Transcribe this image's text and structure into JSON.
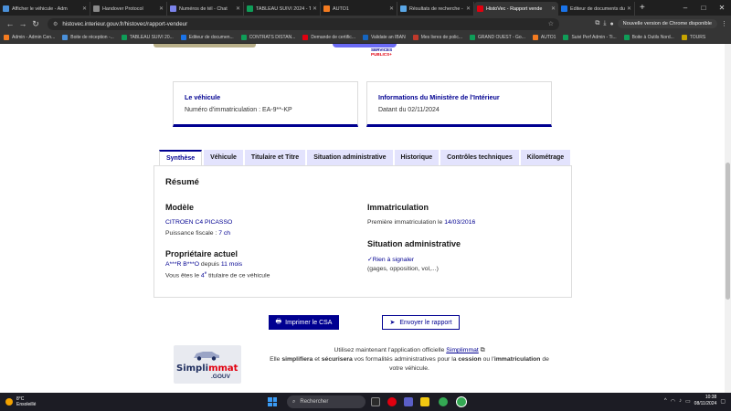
{
  "browser": {
    "tabs": [
      {
        "label": "Afficher le véhicule - Adm",
        "fav": "#4a90d9",
        "w": 99,
        "active": false
      },
      {
        "label": "Handover Protocol",
        "fav": "#8a8a8a",
        "w": 84,
        "active": false
      },
      {
        "label": "Numéros de tél - Chat",
        "fav": "#7b83eb",
        "w": 84,
        "active": false
      },
      {
        "label": "TABLEAU SUIVI 2024 - TO",
        "fav": "#0f9d58",
        "w": 84,
        "active": false
      },
      {
        "label": "AUTO1",
        "fav": "#f47b20",
        "w": 84,
        "active": false
      },
      {
        "label": "Résultats de recherche -",
        "fav": "#5aa7e6",
        "w": 84,
        "active": false
      },
      {
        "label": "HistoVec - Rapport vende",
        "fav": "#e1000f",
        "w": 92,
        "active": true
      },
      {
        "label": "Editeur de documents du",
        "fav": "#1a73e8",
        "w": 84,
        "active": false
      }
    ],
    "url": "histovec.interieur.gouv.fr/histovec/rapport-vendeur",
    "update_label": "Nouvelle version de Chrome disponible",
    "bookmarks": [
      {
        "label": "Admin - Admin Cen...",
        "fav": "#f47b20"
      },
      {
        "label": "Boite de réception -...",
        "fav": "#4a90d9"
      },
      {
        "label": "TABLEAU SUIVI 20...",
        "fav": "#0f9d58"
      },
      {
        "label": "Editeur de documen...",
        "fav": "#1a73e8"
      },
      {
        "label": "CONTRATS DISTAN...",
        "fav": "#0f9d58"
      },
      {
        "label": "Demande de certific...",
        "fav": "#e1000f"
      },
      {
        "label": "Validate an IBAN",
        "fav": "#1565c0"
      },
      {
        "label": "Mes livres de polic...",
        "fav": "#c0392b"
      },
      {
        "label": "GRAND OUEST - Go...",
        "fav": "#0f9d58"
      },
      {
        "label": "AUTO1",
        "fav": "#f47b20"
      },
      {
        "label": "Suivi Perf Admin - Ti...",
        "fav": "#0f9d58"
      },
      {
        "label": "Boite à Outils Nord...",
        "fav": "#0f9d58"
      },
      {
        "label": "TOURS",
        "fav": "#c7a400"
      }
    ]
  },
  "header": {
    "logo_top": "SERVICES",
    "logo_bottom": "PUBLICS+"
  },
  "cards": {
    "vehicle_title": "Le véhicule",
    "vehicle_text": "Numéro d'immatriculation : EA-9**-KP",
    "ministry_title": "Informations du Ministère de l'Intérieur",
    "ministry_text": "Datant du 02/11/2024"
  },
  "tabs": [
    "Synthèse",
    "Véhicule",
    "Titulaire et Titre",
    "Situation administrative",
    "Historique",
    "Contrôles techniques",
    "Kilométrage"
  ],
  "summary": {
    "title": "Résumé",
    "model_h": "Modèle",
    "model_name": "CITROEN C4 PICASSO",
    "fiscal_label": "Puissance fiscale : ",
    "fiscal_value": "7 ch",
    "owner_h": "Propriétaire actuel",
    "owner_name": "A***R B***O",
    "owner_since": " depuis ",
    "owner_duration": "11 mois",
    "holder_prefix": "Vous êtes le ",
    "holder_rank": "4",
    "holder_suffix": " titulaire de ce véhicule",
    "registration_h": "Immatriculation",
    "first_reg_label": "Première immatriculation le ",
    "first_reg_date": "14/03/2016",
    "admin_h": "Situation administrative",
    "admin_status": "Rien à signaler",
    "admin_details": "(gages, opposition, vol,...)"
  },
  "actions": {
    "print_label": "Imprimer le CSA",
    "send_label": "Envoyer le rapport"
  },
  "promo": {
    "logo_word_a": "Simpli",
    "logo_word_b": "mmat",
    "logo_gouv": ".GOUV",
    "line1_prefix": "Utilisez maintenant l'application officielle ",
    "line1_link": "Simplimmat",
    "line2_a": "Elle ",
    "line2_b": "simplifiera",
    "line2_c": " et ",
    "line2_d": "sécurisera",
    "line2_e": " vos formalités administratives pour la ",
    "line2_f": "cession",
    "line2_g": " ou l'",
    "line2_h": "immatriculation",
    "line2_i": " de",
    "line3": "votre véhicule."
  },
  "taskbar": {
    "temp": "8°C",
    "weather": "Ensoleillé",
    "search_placeholder": "Rechercher",
    "time": "10:38",
    "date": "08/11/2024"
  }
}
